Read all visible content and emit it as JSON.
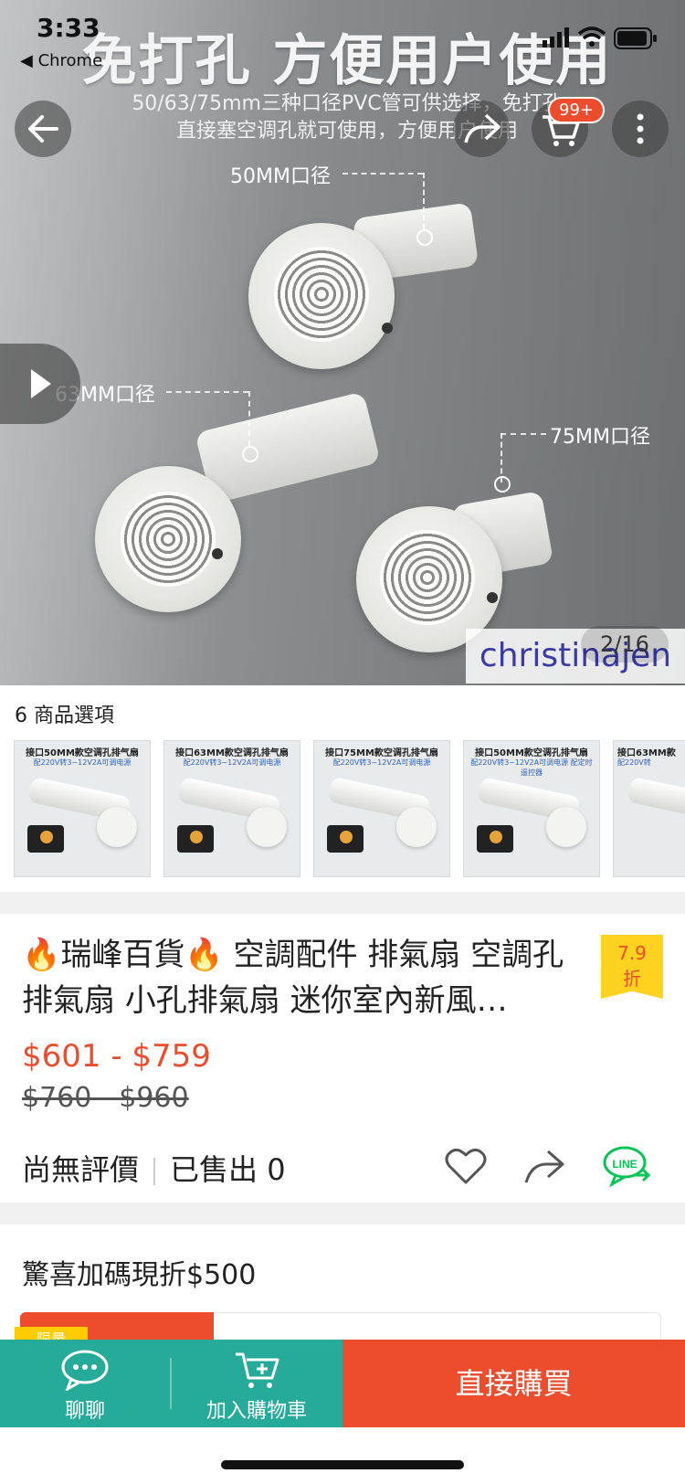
{
  "status_bar": {
    "time": "3:33",
    "back_app": "◀ Chrome"
  },
  "hero": {
    "headline": "免打孔 方便用户使用",
    "sub_line1": "50/63/75mm三种口径PVC管可供选择，免打孔",
    "sub_line2": "直接塞空调孔就可使用，方便用户使用",
    "labels": {
      "d50": "50MM口径",
      "d63": "63MM口径",
      "d75": "75MM口径"
    },
    "cart_badge": "99+",
    "pager": "2/16",
    "watermark": "christinajen"
  },
  "options": {
    "label": "6 商品選項",
    "thumbnails": [
      {
        "title": "接口50MM款空调孔排气扇",
        "sub": "配220V转3~12V2A可调电源"
      },
      {
        "title": "接口63MM款空调孔排气扇",
        "sub": "配220V转3~12V2A可调电源"
      },
      {
        "title": "接口75MM款空调孔排气扇",
        "sub": "配220V转3~12V2A可调电源"
      },
      {
        "title": "接口50MM款空调孔排气扇",
        "sub": "配220V转3~12V2A可调电源 配定时遥控器"
      },
      {
        "title": "接口63MM款",
        "sub": "配220V转"
      }
    ]
  },
  "product": {
    "flame": "🔥",
    "shop": "瑞峰百貨",
    "title_rest": " 空調配件 排氣扇  空調孔排氣扇  小孔排氣扇 迷你室內新風…",
    "discount_value": "7.9",
    "discount_unit": "折",
    "price": "$601 - $759",
    "original_price": "$760 - $960",
    "rating": "尚無評價",
    "sold": "已售出 0",
    "line_label": "LINE"
  },
  "promo": {
    "title": "驚喜加碼現折$500",
    "tag": "限量"
  },
  "bottom_bar": {
    "chat": "聊聊",
    "add_cart": "加入購物車",
    "buy_now": "直接購買"
  },
  "colors": {
    "brand": "#ee4d2d",
    "teal": "#26aa99",
    "line_green": "#06c755",
    "badge_yellow": "#ffd21f"
  }
}
